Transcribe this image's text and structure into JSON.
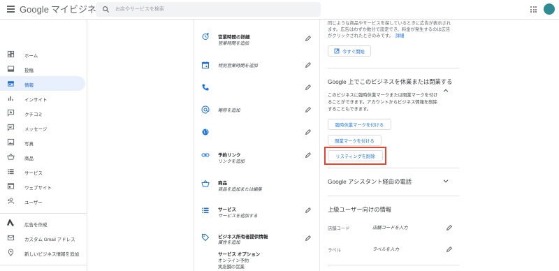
{
  "header": {
    "brand_google": "Google",
    "brand_rest": "マイビジネス",
    "search_placeholder": "お店やサービスを検索",
    "avatar_color": "#2e8b93"
  },
  "sidebar": {
    "items": [
      {
        "label": "ホーム",
        "icon": "dashboard-icon"
      },
      {
        "label": "投稿",
        "icon": "posts-icon"
      },
      {
        "label": "情報",
        "icon": "storefront-icon",
        "active": true
      },
      {
        "label": "インサイト",
        "icon": "bar-chart-icon"
      },
      {
        "label": "クチコミ",
        "icon": "reviews-icon"
      },
      {
        "label": "メッセージ",
        "icon": "message-icon"
      },
      {
        "label": "写真",
        "icon": "photo-icon"
      },
      {
        "label": "商品",
        "icon": "basket-icon"
      },
      {
        "label": "サービス",
        "icon": "services-icon"
      },
      {
        "label": "ウェブサイト",
        "icon": "website-icon"
      },
      {
        "label": "ユーザー",
        "icon": "add-user-icon"
      }
    ],
    "extra": [
      {
        "label": "広告を作成",
        "icon": "google-ads-icon"
      },
      {
        "label": "カスタム Gmail アドレス",
        "icon": "mail-icon"
      },
      {
        "label": "新しいビジネス情報を追加",
        "icon": "location-pin-icon"
      }
    ]
  },
  "info_rows": {
    "hours_title": "営業時間の詳細",
    "hours_sub": "営業時間を追加",
    "special_hours": "特別営業時間を追加",
    "short_name": "略称を追加",
    "booking_title": "予約リンク",
    "booking_sub": "リンクを追加",
    "products_title": "商品",
    "products_sub": "商品を追加または編集",
    "services_title": "サービス",
    "services_sub": "サービスを追加する",
    "attributes_title": "ビジネス所有者提供情報",
    "attributes_sub": "属性を追加",
    "service_options_title": "サービス オプション",
    "service_options_1": "オンライン予約",
    "service_options_2": "実店舗の営業"
  },
  "right": {
    "ads_line1": "同じような商品やサービスを探しているときに広告が表示され",
    "ads_line2": "ます。広告はわずか数分で設定でき、料金が発生するのは広告",
    "ads_line3": "がクリックされたときのみです。",
    "ads_link": "詳細",
    "start_now": "今すぐ開始",
    "close_title": "Google 上でこのビジネスを休業または閉業する",
    "close_desc1": "このビジネスに臨時休業マークまたは閉業マークを付け",
    "close_desc2": "ることができます。アカウントからビジネス情報を削除",
    "close_desc3": "することもできます。",
    "btn_temp_closed": "臨時休業マークを付ける",
    "btn_closed": "閉業マークを付ける",
    "btn_remove": "リスティングを削除",
    "assistant_title": "Google アシスタント経由の電話",
    "advanced_title": "上級ユーザー向けの情報",
    "store_code_label": "店舗コード",
    "store_code_value": "店舗コードを入力",
    "labels_label": "ラベル",
    "labels_value": "ラベルを入力",
    "accent": "#1a73e8",
    "highlight_color": "#e8432f"
  }
}
